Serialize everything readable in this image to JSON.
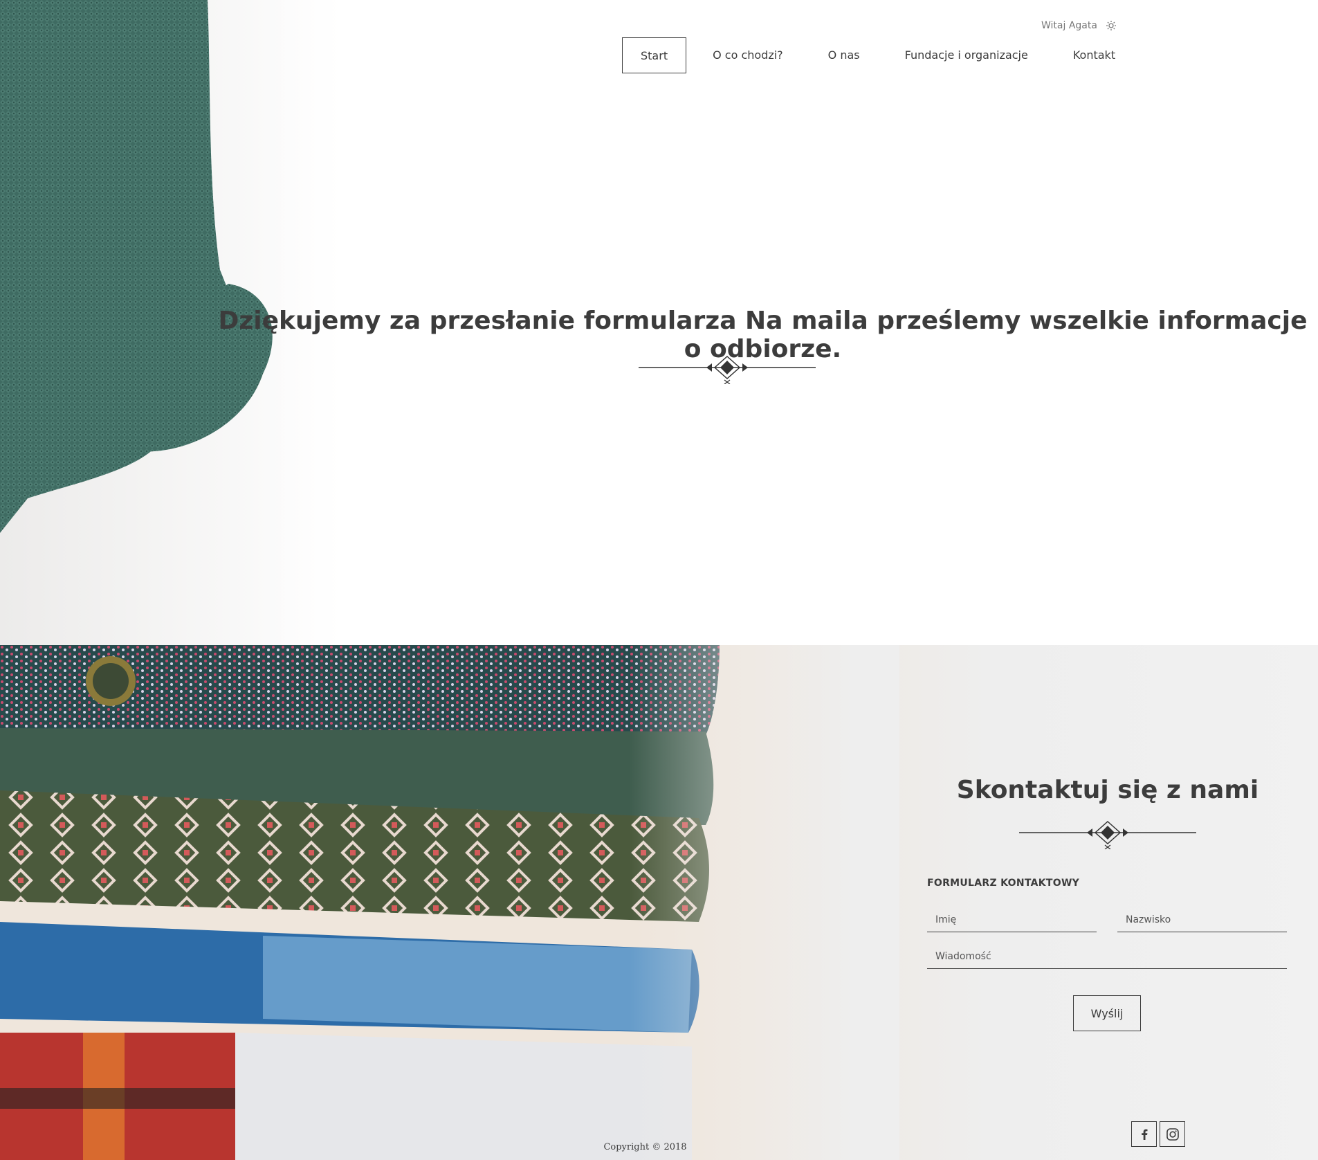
{
  "header": {
    "welcome_text": "Witaj Agata",
    "settings_icon": "gear-icon"
  },
  "nav": {
    "items": [
      {
        "label": "Start",
        "active": true
      },
      {
        "label": "O co chodzi?"
      },
      {
        "label": "O nas"
      },
      {
        "label": "Fundacje i organizacje"
      },
      {
        "label": "Kontakt"
      }
    ]
  },
  "hero": {
    "message": "Dziękujemy za przesłanie formularza Na maila prześlemy wszelkie informacje o odbiorze."
  },
  "contact": {
    "title": "Skontaktuj się z nami",
    "form_label": "FORMULARZ KONTAKTOWY",
    "first_name_placeholder": "Imię",
    "last_name_placeholder": "Nazwisko",
    "message_placeholder": "Wiadomość",
    "submit_label": "Wyślij"
  },
  "footer": {
    "copyright": "Copyright © 2018",
    "social": [
      {
        "icon": "facebook-icon"
      },
      {
        "icon": "instagram-icon"
      }
    ]
  },
  "colors": {
    "text": "#3c3c3c",
    "sweater_green": "#3f6b62",
    "background": "#ffffff"
  }
}
